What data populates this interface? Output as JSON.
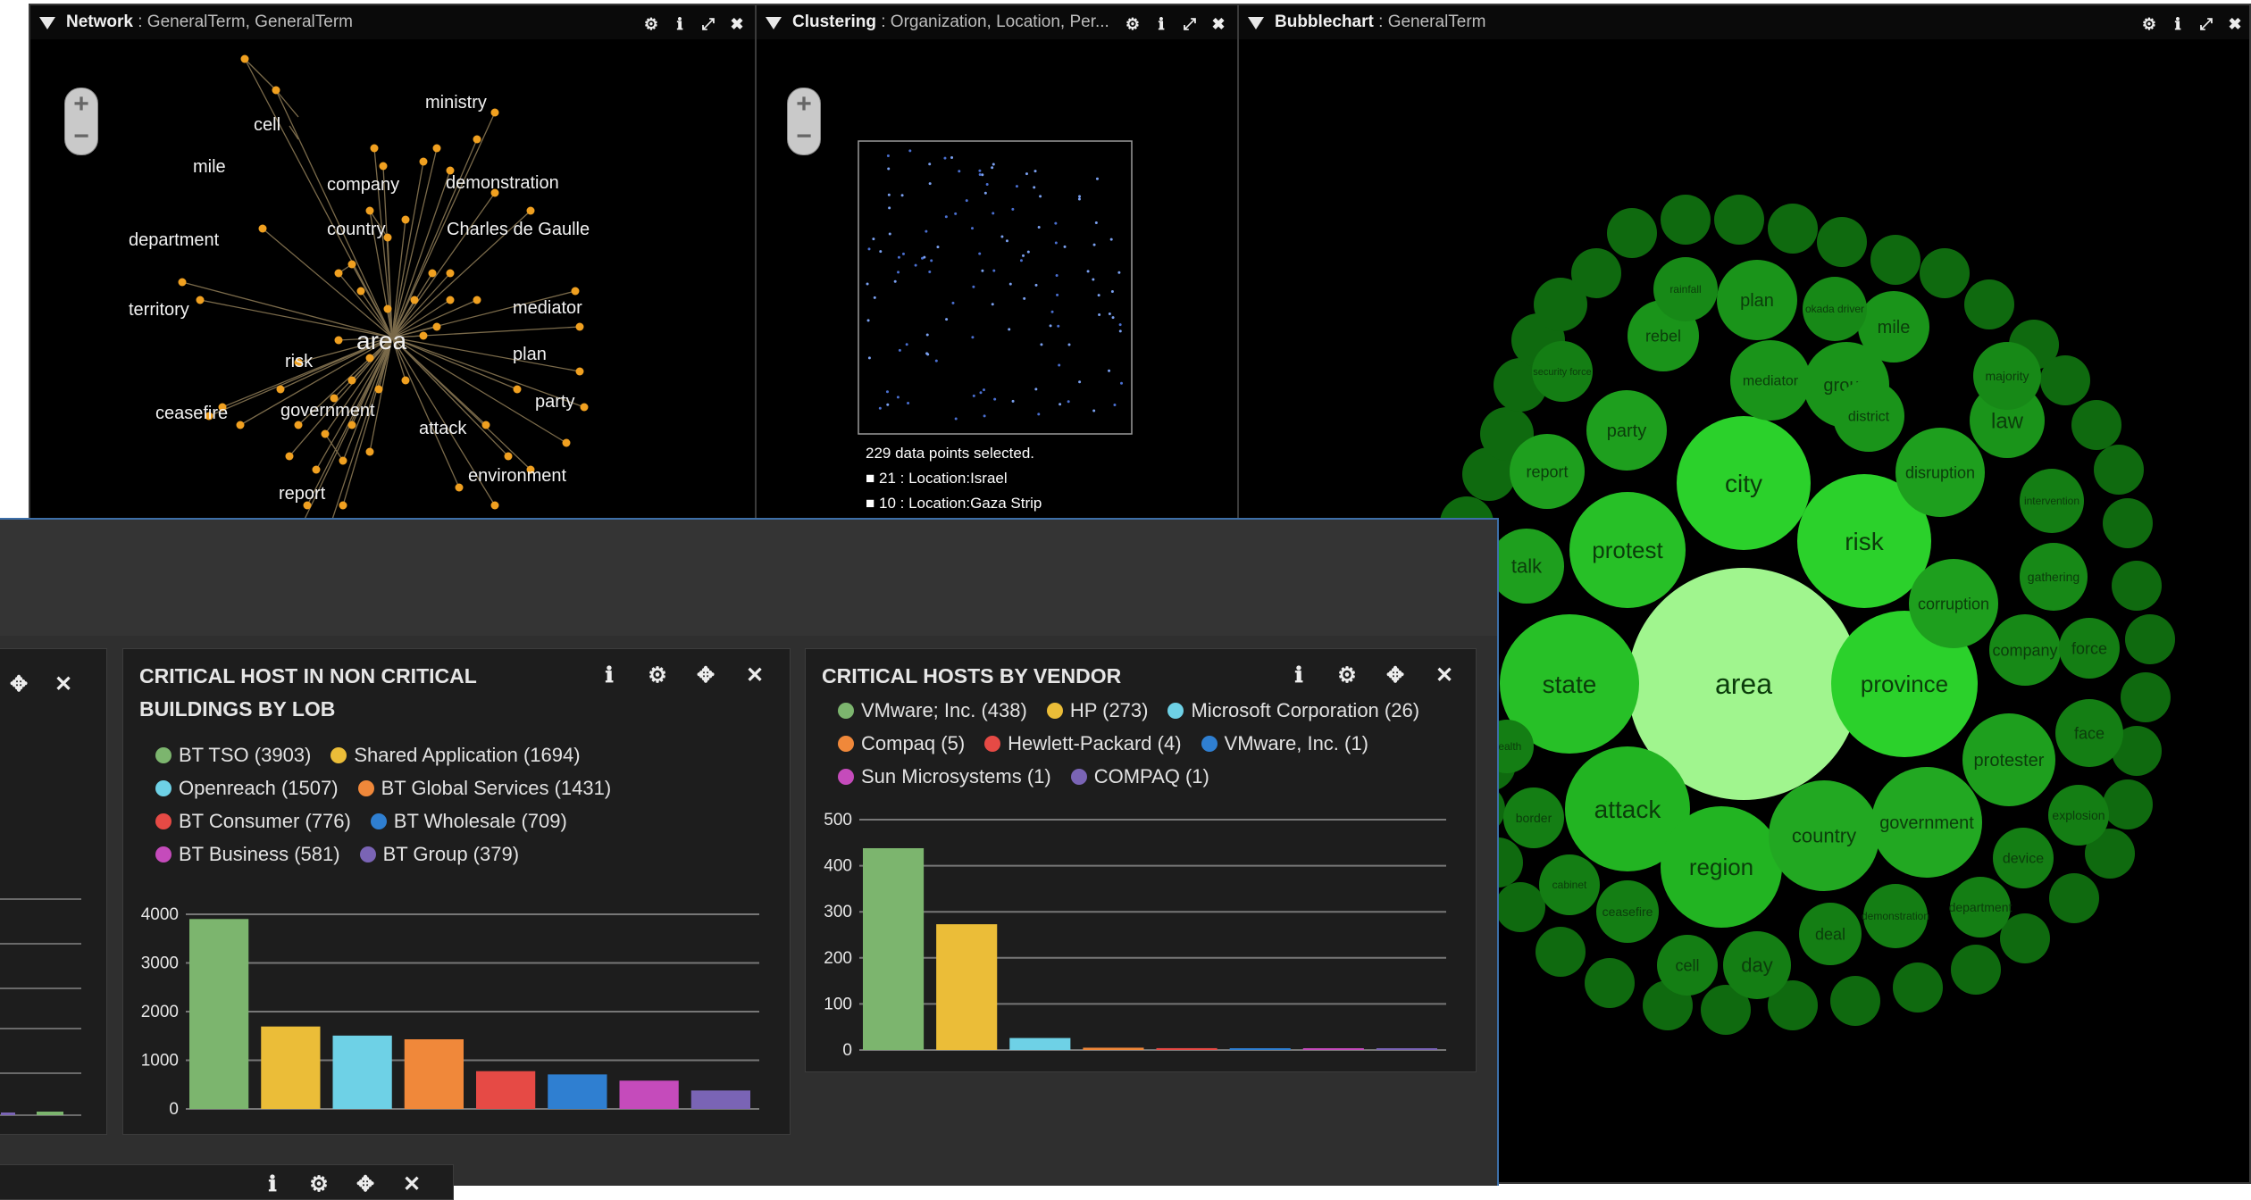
{
  "network_panel": {
    "title": "Network",
    "subtitle": ": GeneralTerm, GeneralTerm",
    "labels": [
      "ministry",
      "cell",
      "mile",
      "company",
      "demonstration",
      "department",
      "country",
      "Charles de Gaulle",
      "territory",
      "area",
      "mediator",
      "risk",
      "plan",
      "government",
      "party",
      "ceasefire",
      "attack",
      "environment",
      "report"
    ],
    "icons": [
      "gear-icon",
      "info-icon",
      "popout-icon",
      "close-icon"
    ]
  },
  "clustering_panel": {
    "title": "Clustering",
    "subtitle": ": Organization, Location, Per...",
    "selected_text": "229 data points selected.",
    "items": [
      "21 : Location:Israel",
      "10 : Location:Gaza Strip"
    ]
  },
  "bubble_panel": {
    "title": "Bubblechart",
    "subtitle": ": GeneralTerm",
    "bubbles": [
      "area",
      "city",
      "risk",
      "protest",
      "province",
      "state",
      "attack",
      "region",
      "country",
      "government",
      "protester",
      "corruption",
      "disruption",
      "talk",
      "report",
      "party",
      "rebel",
      "plan",
      "group",
      "mediator",
      "district",
      "mile",
      "law",
      "majority",
      "company",
      "force",
      "face",
      "explosion",
      "device",
      "department",
      "demonstration",
      "deal",
      "day",
      "cell",
      "ceasefire",
      "cabinet",
      "border",
      "gathering",
      "intervention",
      "security force",
      "okada driver",
      "rainfall",
      "health"
    ]
  },
  "dashboard": {
    "card_lob": {
      "title_line1": "CRITICAL HOST IN NON CRITICAL",
      "title_line2": "BUILDINGS BY LOB",
      "legend": [
        {
          "label": "BT TSO (3903)",
          "color": "#7cb56e"
        },
        {
          "label": "Shared Application (1694)",
          "color": "#ebbd38"
        },
        {
          "label": "Openreach (1507)",
          "color": "#6ed1e6"
        },
        {
          "label": "BT Global Services (1431)",
          "color": "#f0883a"
        },
        {
          "label": "BT Consumer (776)",
          "color": "#e64a45"
        },
        {
          "label": "BT Wholesale (709)",
          "color": "#2f7fd1"
        },
        {
          "label": "BT Business (581)",
          "color": "#c54bbb"
        },
        {
          "label": "BT Group (379)",
          "color": "#7a64b5"
        }
      ],
      "y_ticks": [
        "4000",
        "3000",
        "2000",
        "1000",
        "0"
      ]
    },
    "card_vendor": {
      "title": "CRITICAL HOSTS BY VENDOR",
      "legend": [
        {
          "label": "VMware; Inc. (438)",
          "color": "#7cb56e"
        },
        {
          "label": "HP (273)",
          "color": "#ebbd38"
        },
        {
          "label": "Microsoft Corporation (26)",
          "color": "#6ed1e6"
        },
        {
          "label": "Compaq (5)",
          "color": "#f0883a"
        },
        {
          "label": "Hewlett-Packard (4)",
          "color": "#e64a45"
        },
        {
          "label": "VMware, Inc. (1)",
          "color": "#2f7fd1"
        },
        {
          "label": "Sun Microsystems (1)",
          "color": "#c54bbb"
        },
        {
          "label": "COMPAQ (1)",
          "color": "#7a64b5"
        }
      ],
      "y_ticks": [
        "500",
        "400",
        "300",
        "200",
        "100",
        "0"
      ]
    }
  },
  "chart_data": [
    {
      "type": "bar",
      "title": "CRITICAL HOST IN NON CRITICAL BUILDINGS BY LOB",
      "categories": [
        "BT TSO",
        "Shared Application",
        "Openreach",
        "BT Global Services",
        "BT Consumer",
        "BT Wholesale",
        "BT Business",
        "BT Group"
      ],
      "values": [
        3903,
        1694,
        1507,
        1431,
        776,
        709,
        581,
        379
      ],
      "colors": [
        "#7cb56e",
        "#ebbd38",
        "#6ed1e6",
        "#f0883a",
        "#e64a45",
        "#2f7fd1",
        "#c54bbb",
        "#7a64b5"
      ],
      "ylim": [
        0,
        4000
      ],
      "grid": true,
      "legend": "top"
    },
    {
      "type": "bar",
      "title": "CRITICAL HOSTS BY VENDOR",
      "categories": [
        "VMware; Inc.",
        "HP",
        "Microsoft Corporation",
        "Compaq",
        "Hewlett-Packard",
        "VMware, Inc.",
        "Sun Microsystems",
        "COMPAQ"
      ],
      "values": [
        438,
        273,
        26,
        5,
        4,
        1,
        1,
        1
      ],
      "colors": [
        "#7cb56e",
        "#ebbd38",
        "#6ed1e6",
        "#f0883a",
        "#e64a45",
        "#2f7fd1",
        "#c54bbb",
        "#7a64b5"
      ],
      "ylim": [
        0,
        500
      ],
      "grid": true,
      "legend": "top"
    }
  ]
}
